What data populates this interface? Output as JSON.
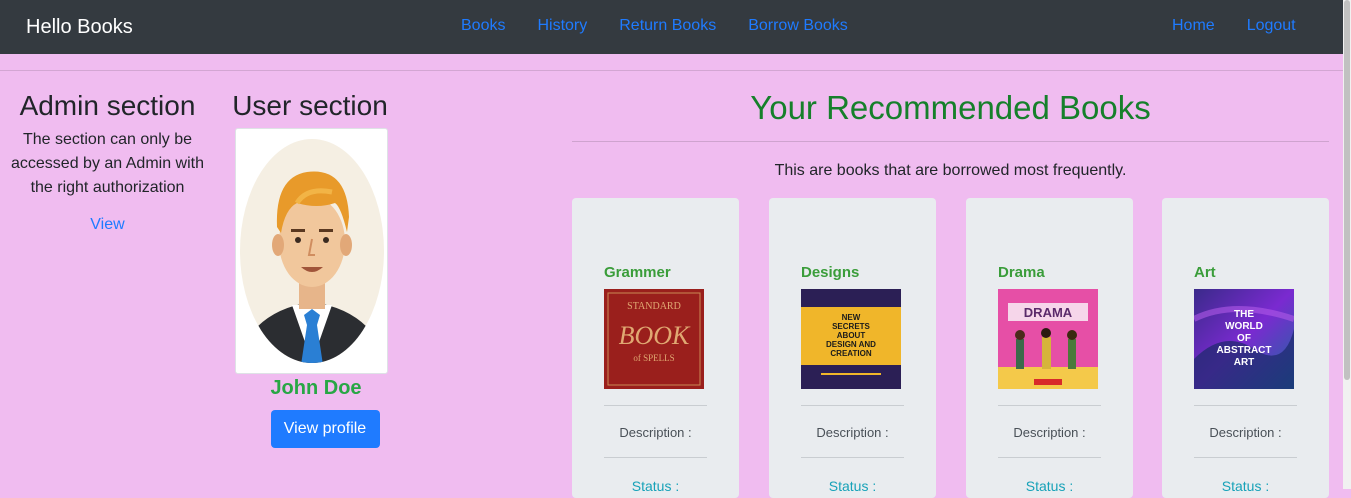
{
  "navbar": {
    "brand": "Hello Books",
    "center_links": [
      "Books",
      "History",
      "Return Books",
      "Borrow Books"
    ],
    "right_links": [
      "Home",
      "Logout"
    ]
  },
  "admin": {
    "title": "Admin section",
    "text": "The section can only be accessed by an Admin with the right authorization",
    "view_label": "View"
  },
  "user": {
    "title": "User section",
    "name": "John Doe",
    "button_label": "View profile"
  },
  "recommended": {
    "title": "Your Recommended Books",
    "subtitle": "This are books that are borrowed most frequently.",
    "books": [
      {
        "title": "Grammer",
        "description_label": "Description :",
        "status_label": "Status :",
        "cover_text": [
          "STANDARD",
          "BOOK",
          "of SPELLS"
        ]
      },
      {
        "title": "Designs",
        "description_label": "Description :",
        "status_label": "Status :",
        "cover_text": [
          "NEW",
          "SECRETS",
          "ABOUT",
          "DESIGN AND",
          "CREATION"
        ]
      },
      {
        "title": "Drama",
        "description_label": "Description :",
        "status_label": "Status :",
        "cover_text": [
          "DRAMA"
        ]
      },
      {
        "title": "Art",
        "description_label": "Description :",
        "status_label": "Status :",
        "cover_text": [
          "THE",
          "WORLD",
          "OF",
          "ABSTRACT",
          "ART"
        ]
      }
    ]
  },
  "colors": {
    "navbar_bg": "#343a40",
    "page_bg": "#f0bcf0",
    "link": "#1f7bff",
    "heading_green": "#16802b",
    "card_bg": "#e9ecef"
  }
}
